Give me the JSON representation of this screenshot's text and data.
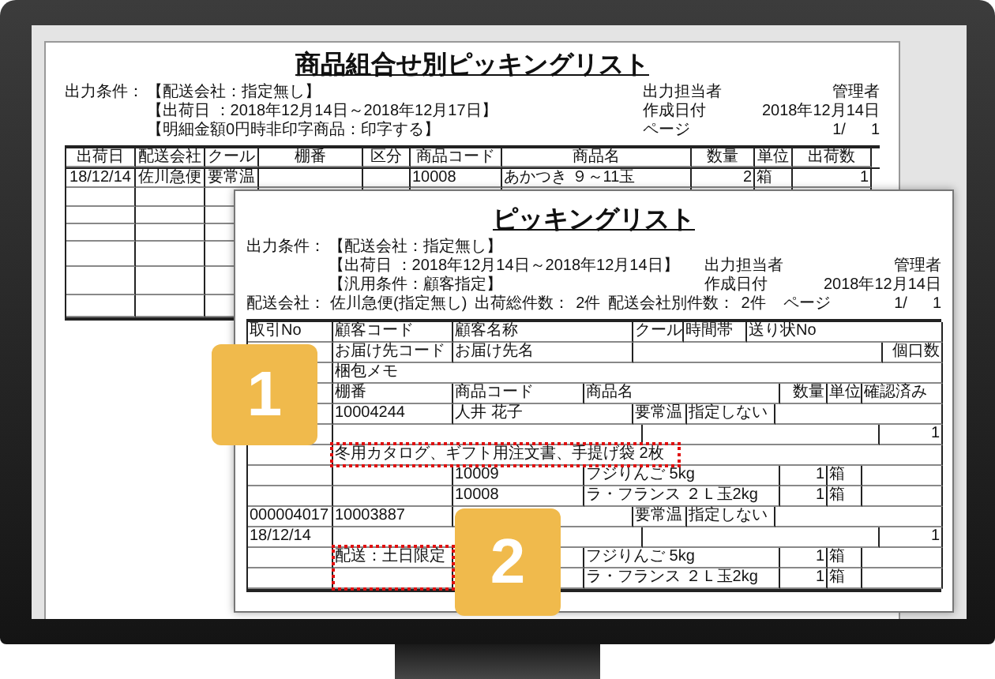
{
  "back_document": {
    "title": "商品組合せ別ピッキングリスト",
    "conditions_label": "出力条件：",
    "conditions": [
      "【配送会社：指定無し】",
      "【出荷日 ：2018年12月14日～2018年12月17日】",
      "【明細金額0円時非印字商品：印字する】"
    ],
    "meta": [
      {
        "label": "出力担当者",
        "values": [
          "管理者"
        ]
      },
      {
        "label": "作成日付",
        "values": [
          "2018年12月14日"
        ]
      },
      {
        "label": "ページ",
        "values": [
          "1/",
          "1"
        ]
      }
    ],
    "table": {
      "columns": [
        "出荷日",
        "配送会社",
        "クール",
        "棚番",
        "区分",
        "商品コード",
        "商品名",
        "数量",
        "単位",
        "出荷数"
      ],
      "rows": [
        [
          "18/12/14",
          "佐川急便",
          "要常温",
          null,
          null,
          "10008",
          "あかつき ９～11玉",
          "2",
          "箱",
          "1"
        ]
      ]
    }
  },
  "front_document": {
    "title": "ピッキングリスト",
    "conditions_label": "出力条件：",
    "conditions": [
      "【配送会社：指定無し】",
      "【出荷日 ：2018年12月14日～2018年12月14日】",
      "【汎用条件：顧客指定】"
    ],
    "meta": [
      {
        "label": "出力担当者",
        "values": [
          "管理者"
        ]
      },
      {
        "label": "作成日付",
        "values": [
          "2018年12月14日"
        ]
      },
      {
        "label": "ページ",
        "values": [
          "1/",
          "1"
        ]
      }
    ],
    "summary": [
      {
        "label": "配送会社：",
        "value": "佐川急便(指定無し)"
      },
      {
        "label": "出荷総件数：",
        "value": "2件"
      },
      {
        "label": "配送会社別件数：",
        "value": "2件"
      }
    ],
    "table_rows": [
      {
        "kind": "header_customer",
        "trade_no": "取引No",
        "customer_code": "顧客コード",
        "customer_name": "顧客名称",
        "cool": "クール",
        "time_slot": "時間帯",
        "slip_no": "送り状No"
      },
      {
        "kind": "header_destination",
        "dest_code": "お届け先コード",
        "dest_name": "お届け先名",
        "parcels": "個口数"
      },
      {
        "kind": "header_memo",
        "memo": "梱包メモ"
      },
      {
        "kind": "header_item",
        "shelf": "棚番",
        "item_code": "商品コード",
        "item_name": "商品名",
        "qty": "数量",
        "unit": "単位",
        "checked": "確認済み"
      },
      {
        "kind": "customer",
        "customer_code": "10004244",
        "customer_name": "人井 花子",
        "cool": "要常温",
        "time_slot": "指定しない"
      },
      {
        "kind": "count",
        "parcels": "1"
      },
      {
        "kind": "note",
        "memo": "冬用カタログ、ギフト用注文書、手提げ袋 2枚"
      },
      {
        "kind": "item",
        "item_code": "10009",
        "item_name": "フジりんご 5kg",
        "qty": "1",
        "unit": "箱"
      },
      {
        "kind": "item",
        "item_code": "10008",
        "item_name": "ラ・フランス ２Ｌ玉2kg",
        "qty": "1",
        "unit": "箱"
      },
      {
        "kind": "customer",
        "trade_no": "000004017",
        "customer_code": "10003887",
        "cool": "要常温",
        "time_slot": "指定しない"
      },
      {
        "kind": "count",
        "ship_date": "18/12/14",
        "parcels": "1"
      },
      {
        "kind": "item",
        "shelf": "配送：土日限定",
        "item_name": "フジりんご 5kg",
        "qty": "1",
        "unit": "箱"
      },
      {
        "kind": "item",
        "item_name": "ラ・フランス ２Ｌ玉2kg",
        "qty": "1",
        "unit": "箱"
      }
    ]
  },
  "callouts": [
    {
      "number": "1"
    },
    {
      "number": "2"
    }
  ]
}
